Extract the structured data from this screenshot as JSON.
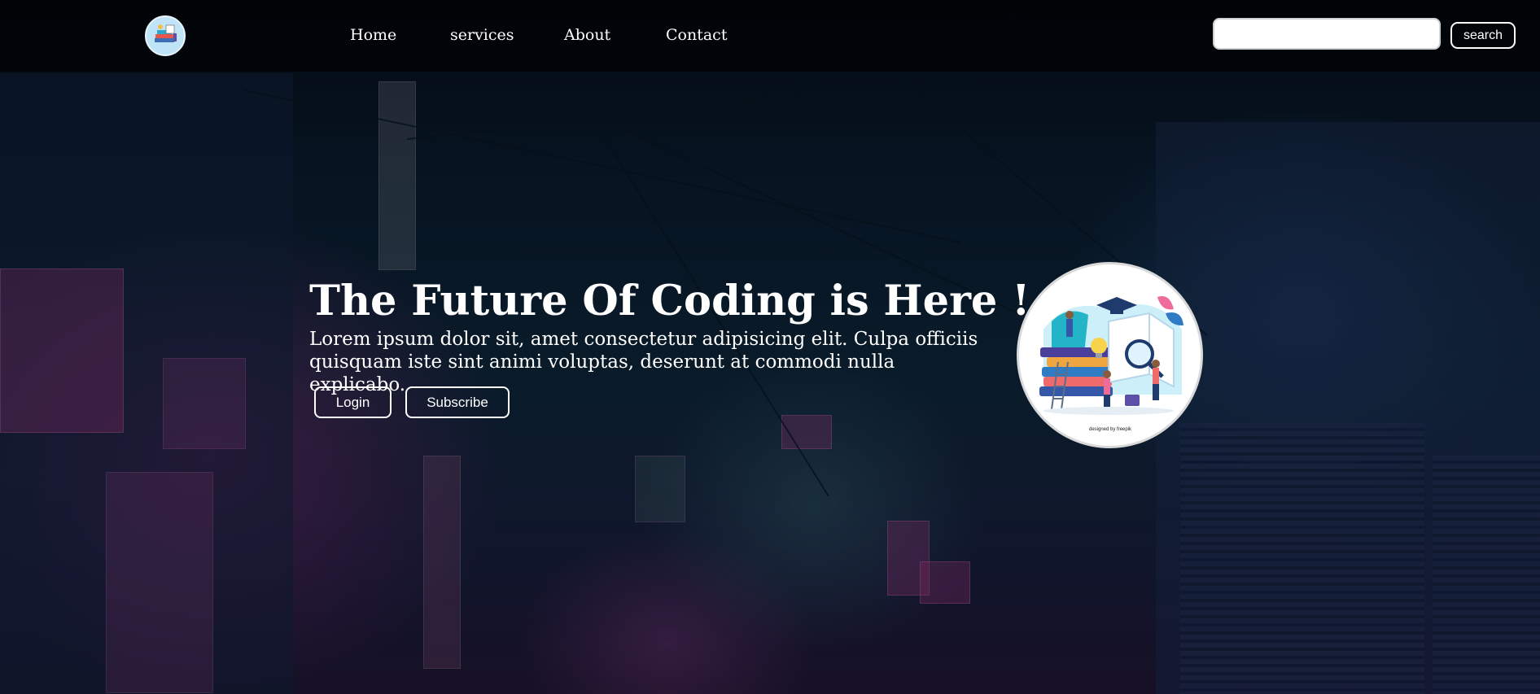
{
  "header": {
    "logo_alt": "site logo",
    "nav": [
      "Home",
      "services",
      "About",
      "Contact"
    ],
    "search": {
      "placeholder": "",
      "value": "",
      "button_label": "search"
    }
  },
  "hero": {
    "title": "The Future Of Coding is Here !",
    "text": "Lorem ipsum dolor sit, amet consectetur adipisicing elit. Culpa officiis quisquam iste sint animi voluptas, deserunt at commodi nulla explicabo.",
    "login_label": "Login",
    "subscribe_label": "Subscribe",
    "illustration_credit": "designed by freepik"
  },
  "colors": {
    "text": "#ffffff",
    "header_bg": "#000000",
    "background": "#0f2638",
    "accent_neon": "#be3c8c"
  },
  "icons": {
    "logo": "books-illustration-icon",
    "hero_image": "education-illustration"
  }
}
